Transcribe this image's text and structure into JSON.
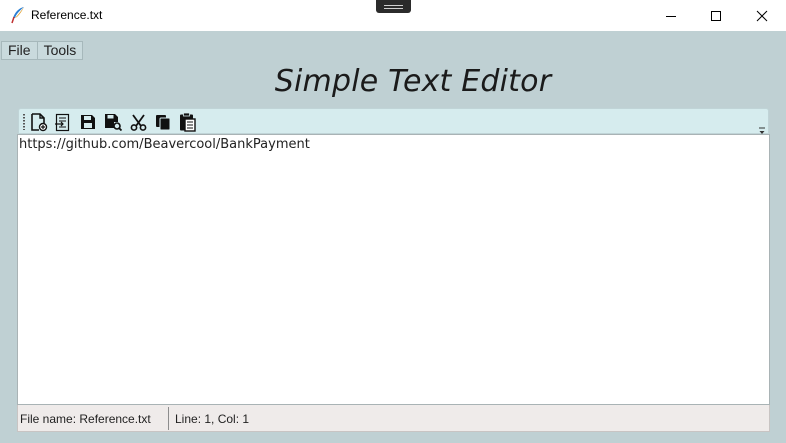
{
  "window": {
    "title": "Reference.txt",
    "app_icon": "quill-icon",
    "controls": [
      "minimize-icon",
      "maximize-icon",
      "close-icon"
    ]
  },
  "menu": {
    "items": [
      {
        "label": "File"
      },
      {
        "label": "Tools"
      }
    ]
  },
  "heading": "Simple Text Editor",
  "toolbar": {
    "buttons": [
      {
        "icon": "new-file-icon"
      },
      {
        "icon": "open-file-icon"
      },
      {
        "icon": "save-icon"
      },
      {
        "icon": "save-as-icon"
      },
      {
        "icon": "cut-icon"
      },
      {
        "icon": "copy-icon"
      },
      {
        "icon": "paste-icon"
      }
    ]
  },
  "editor": {
    "content": "https://github.com/Beavercool/BankPayment"
  },
  "status": {
    "file_name": "File name: Reference.txt",
    "position": "Line: 1, Col: 1"
  },
  "colors": {
    "background": "#bfd0d3",
    "toolbar": "#d6ecee",
    "statusbar": "#efebea"
  }
}
